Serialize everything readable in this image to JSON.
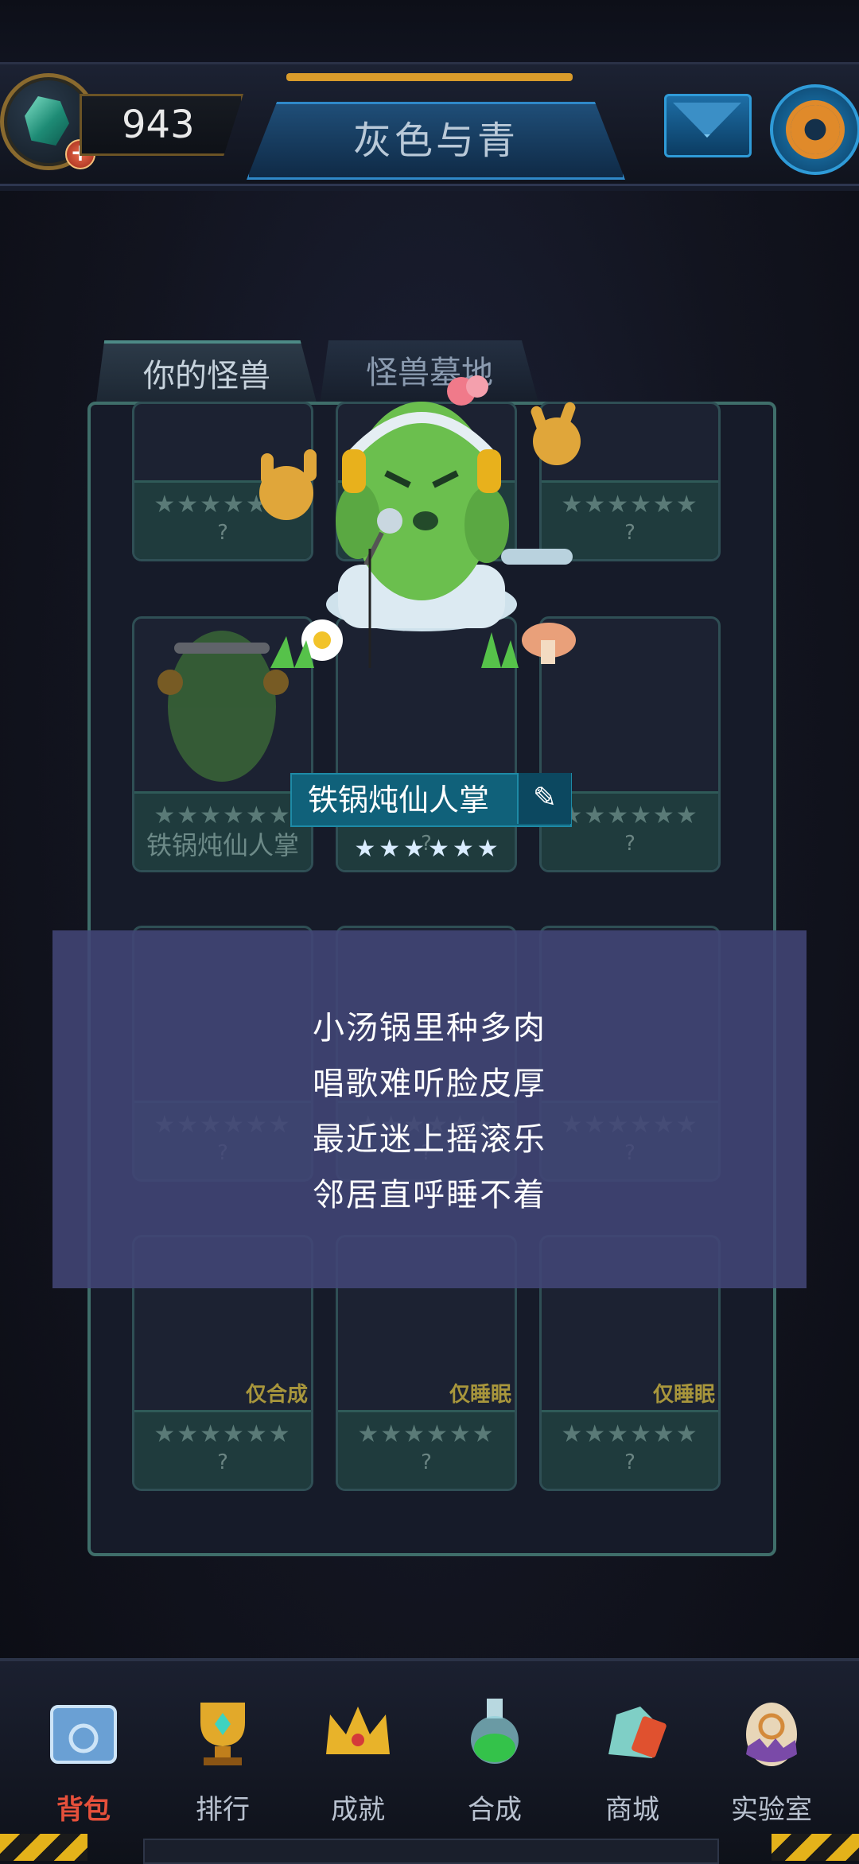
{
  "header": {
    "gem_count": "943",
    "title": "灰色与青"
  },
  "tabs": {
    "your_monsters": "你的怪兽",
    "monster_graveyard": "怪兽墓地"
  },
  "slots": {
    "unknown": "?",
    "stars": "★★★★★★",
    "cactus_name": "铁锅炖仙人掌",
    "tag_synth_only": "仅合成",
    "tag_sleep_only": "仅睡眠"
  },
  "selected_monster": {
    "name": "铁锅炖仙人掌",
    "stars": "★★★★★★"
  },
  "description": {
    "line1": "小汤锅里种多肉",
    "line2": "唱歌难听脸皮厚",
    "line3": "最近迷上摇滚乐",
    "line4": "邻居直呼睡不着"
  },
  "nav": {
    "bag": "背包",
    "ranking": "排行",
    "achievement": "成就",
    "synthesis": "合成",
    "shop": "商城",
    "lab": "实验室"
  },
  "colors": {
    "accent_teal": "#3f6e6a",
    "nav_active": "#e6503b",
    "overlay": "#424676"
  }
}
